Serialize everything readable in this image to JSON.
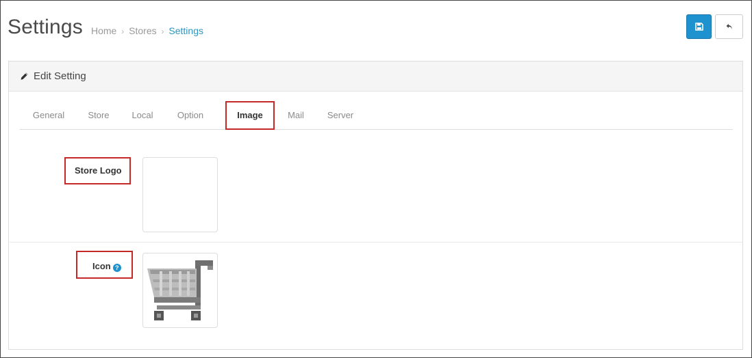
{
  "header": {
    "title": "Settings",
    "breadcrumb": [
      "Home",
      "Stores",
      "Settings"
    ],
    "separator": "›"
  },
  "toolbar": {
    "save_icon": "save-icon",
    "back_icon": "reply-icon"
  },
  "panel": {
    "title": "Edit Setting",
    "title_icon": "pencil-icon"
  },
  "tabs": [
    {
      "label": "General"
    },
    {
      "label": "Store"
    },
    {
      "label": "Local"
    },
    {
      "label": "Option"
    },
    {
      "label": "Image",
      "active": true
    },
    {
      "label": "Mail"
    },
    {
      "label": "Server"
    }
  ],
  "form": {
    "store_logo_label": "Store Logo",
    "icon_label": "Icon",
    "icon_help": "?",
    "icon_image": "shopping-cart-icon"
  },
  "colors": {
    "primary": "#1e91cf",
    "breadcrumb_active": "#2996c3",
    "highlight": "#c62828"
  }
}
